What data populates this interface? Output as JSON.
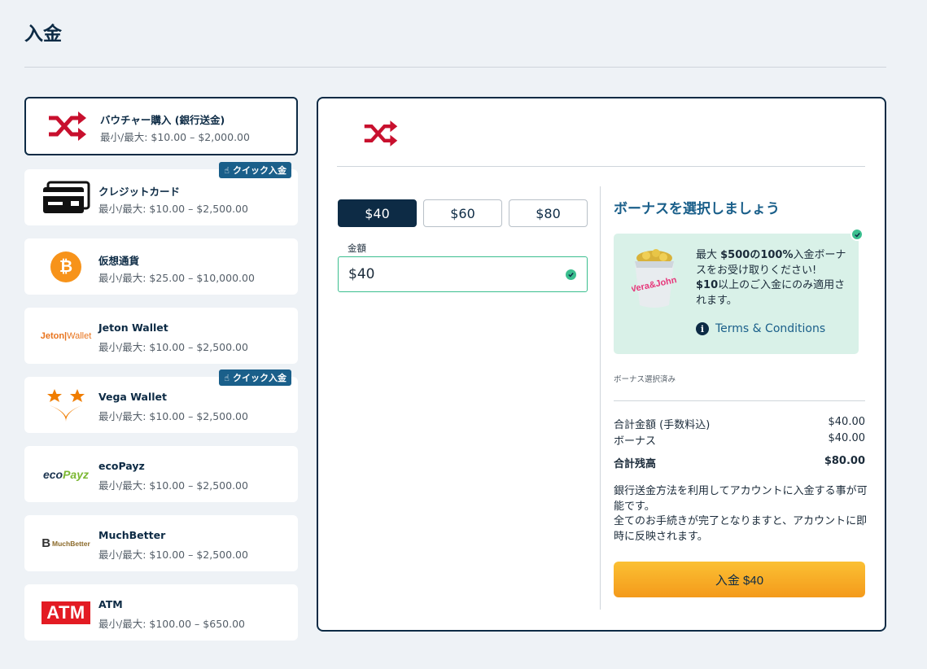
{
  "page": {
    "title": "入金"
  },
  "methods": [
    {
      "name": "バウチャー購入 (銀行送金)",
      "limits": "最小/最大: $10.00 – $2,000.00",
      "logo": "shuffle-icon",
      "selected": true
    },
    {
      "name": "クレジットカード",
      "limits": "最小/最大: $10.00 – $2,500.00",
      "logo": "credit-card-icon",
      "badge": "クイック入金"
    },
    {
      "name": "仮想通貨",
      "limits": "最小/最大: $25.00 – $10,000.00",
      "logo": "bitcoin-icon",
      "logo_text": "₿"
    },
    {
      "name": "Jeton Wallet",
      "limits": "最小/最大: $10.00 – $2,500.00",
      "logo": "jeton-logo",
      "logo_text_a": "Jeton",
      "logo_text_b": "Wallet"
    },
    {
      "name": "Vega Wallet",
      "limits": "最小/最大: $10.00 – $2,500.00",
      "logo": "vega-wallet-logo",
      "badge": "クイック入金"
    },
    {
      "name": "ecoPayz",
      "limits": "最小/最大: $10.00 – $2,500.00",
      "logo": "ecopayz-logo",
      "logo_text_a": "eco",
      "logo_text_b": "Payz"
    },
    {
      "name": "MuchBetter",
      "limits": "最小/最大: $10.00 – $2,500.00",
      "logo": "muchbetter-logo",
      "logo_text_a": "B",
      "logo_text_b": "MuchBetter"
    },
    {
      "name": "ATM",
      "limits": "最小/最大: $100.00 – $650.00",
      "logo": "atm-logo",
      "logo_text": "ATM"
    }
  ],
  "deposit": {
    "amount_options": [
      "$40",
      "$60",
      "$80"
    ],
    "selected_amount": "$40",
    "amount_label": "金額",
    "amount_value": "$40"
  },
  "bonus": {
    "heading": "ボーナスを選択しましょう",
    "line1_prefix": "最大 ",
    "line1_bold": "$500の100%",
    "line1_suffix": "入金ボーナスをお受け取りください!",
    "line2_bold": "$10",
    "line2_suffix": "以上のご入金にのみ適用されます。",
    "bucket_text": "Vera&John",
    "terms_label": "Terms & Conditions",
    "selected_note": "ボーナス選択済み"
  },
  "summary": {
    "rows": [
      {
        "label": "合計金額 (手数料込)",
        "value": "$40.00"
      },
      {
        "label": "ボーナス",
        "value": "$40.00"
      },
      {
        "label": "合計残高",
        "value": "$80.00"
      }
    ],
    "info_line1": "銀行送金方法を利用してアカウントに入金する事が可能です。",
    "info_line2": "全てのお手続きが完了となりますと、アカウントに即時に反映されます。",
    "deposit_button": "入金 $40"
  },
  "colors": {
    "navy": "#0d2b45",
    "accent_blue": "#1a5f8a",
    "green": "#3bbf8f",
    "orange": "#f7a623",
    "bonus_bg": "#d9f1e8"
  }
}
